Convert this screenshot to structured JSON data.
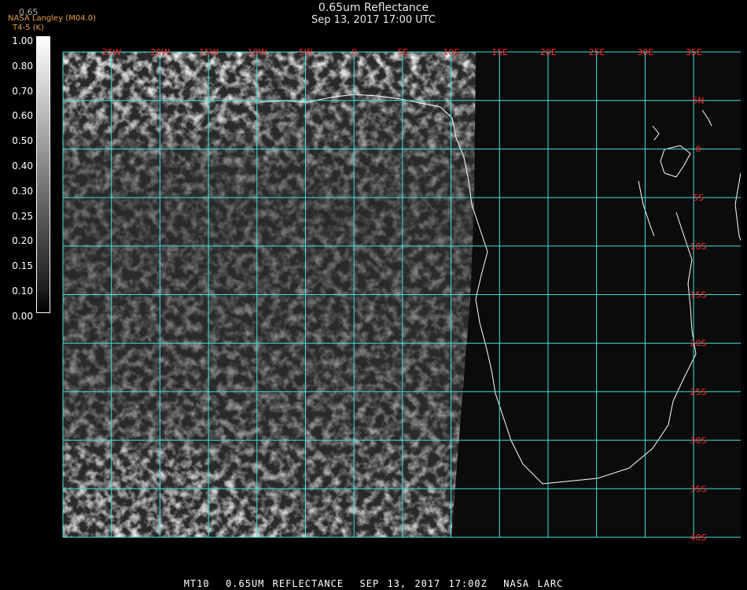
{
  "header": {
    "title": "0.65um Reflectance",
    "subtitle": "Sep 13, 2017 17:00 UTC",
    "credit_org": "NASA Langley (M04.0)",
    "credit_band": "T4-5 (K)"
  },
  "legend": {
    "top_label": "0.65",
    "ticks": [
      "1.00",
      "0.80",
      "0.70",
      "0.60",
      "0.50",
      "0.40",
      "0.30",
      "0.25",
      "0.20",
      "0.15",
      "0.10",
      "0.00"
    ]
  },
  "grid": {
    "longitude_labels": [
      "25W",
      "20W",
      "15W",
      "10W",
      "5W",
      "0",
      "5E",
      "10E",
      "15E",
      "20E",
      "25E",
      "30E",
      "35E"
    ],
    "latitude_labels": [
      "5N",
      "0",
      "5S",
      "10S",
      "15S",
      "20S",
      "25S",
      "30S",
      "35S",
      "40S"
    ]
  },
  "colors": {
    "grid_line": "#40e0e0",
    "grid_label": "#ff3030",
    "coastline": "#ffffff",
    "credit": "#e8a040"
  },
  "footer": "MT10  0.65UM REFLECTANCE  SEP 13, 2017 17:00Z  NASA LARC"
}
